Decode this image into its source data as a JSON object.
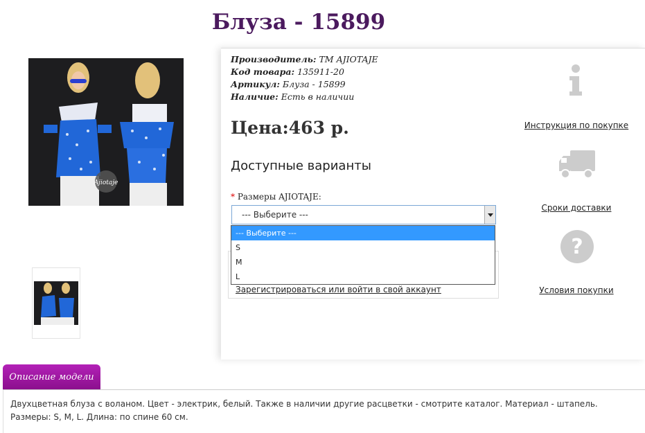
{
  "product": {
    "title": "Блуза - 15899",
    "manufacturer_label": "Производитель:",
    "manufacturer": "ТМ AJIOTAJE",
    "code_label": "Код товара:",
    "code": "135911-20",
    "sku_label": "Артикул:",
    "sku": "Блуза - 15899",
    "stock_label": "Наличие:",
    "stock": "Есть в наличии",
    "price": "Цена:463 р."
  },
  "options": {
    "heading": "Доступные варианты",
    "required_mark": "*",
    "size_label": "Размеры AJIOTAJE:",
    "select_value": "--- Выберите ---",
    "dropdown_items": [
      "--- Выберите ---",
      "S",
      "M",
      "L"
    ]
  },
  "account": {
    "link": "Зарегистрироваться или войти в свой аккаунт"
  },
  "sidebar": {
    "instruction": "Инструкция по покупке",
    "delivery": "Сроки доставки",
    "terms": "Условия покупки"
  },
  "description": {
    "tab": "Описание модели",
    "text": "Двухцветная блуза с воланом. Цвет - электрик, белый. Также в наличии другие расцветки - смотрите каталог. Материал - штапель. Размеры: S, M, L. Длина: по спине 60 см."
  },
  "image": {
    "watermark": "Ajiotaje"
  },
  "colors": {
    "title": "#4b1a5e",
    "tab": "#a318a6",
    "selected_option": "#3399ff",
    "icon_gray": "#cccccc"
  }
}
